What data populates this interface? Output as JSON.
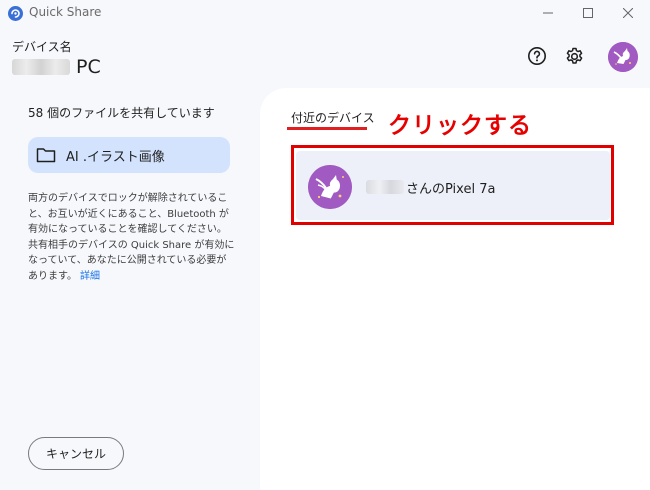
{
  "window": {
    "title": "Quick Share"
  },
  "header": {
    "device_label": "デバイス名",
    "device_name": "PC"
  },
  "left_panel": {
    "file_count_text": "58 個のファイルを共有しています",
    "folder_label": "AI .イラスト画像",
    "info_text": "両方のデバイスでロックが解除されていること、お互いが近くにあること、Bluetooth が有効になっていることを確認してください。共有相手のデバイスの Quick Share が有効になっていて、あなたに公開されている必要があります。",
    "info_link": "詳細",
    "cancel_label": "キャンセル"
  },
  "right_panel": {
    "nearby_title": "付近のデバイス",
    "annotation": "クリックする",
    "device": {
      "name": "さんのPixel 7a"
    }
  },
  "icons": {
    "app": "quick-share-icon",
    "help": "help-icon",
    "settings": "gear-icon",
    "folder": "folder-icon",
    "avatar": "unicorn-avatar"
  },
  "colors": {
    "accent": "#d3e3fd",
    "link": "#1a73e8",
    "annotation": "#e60000",
    "avatar": "#a15ac2"
  }
}
